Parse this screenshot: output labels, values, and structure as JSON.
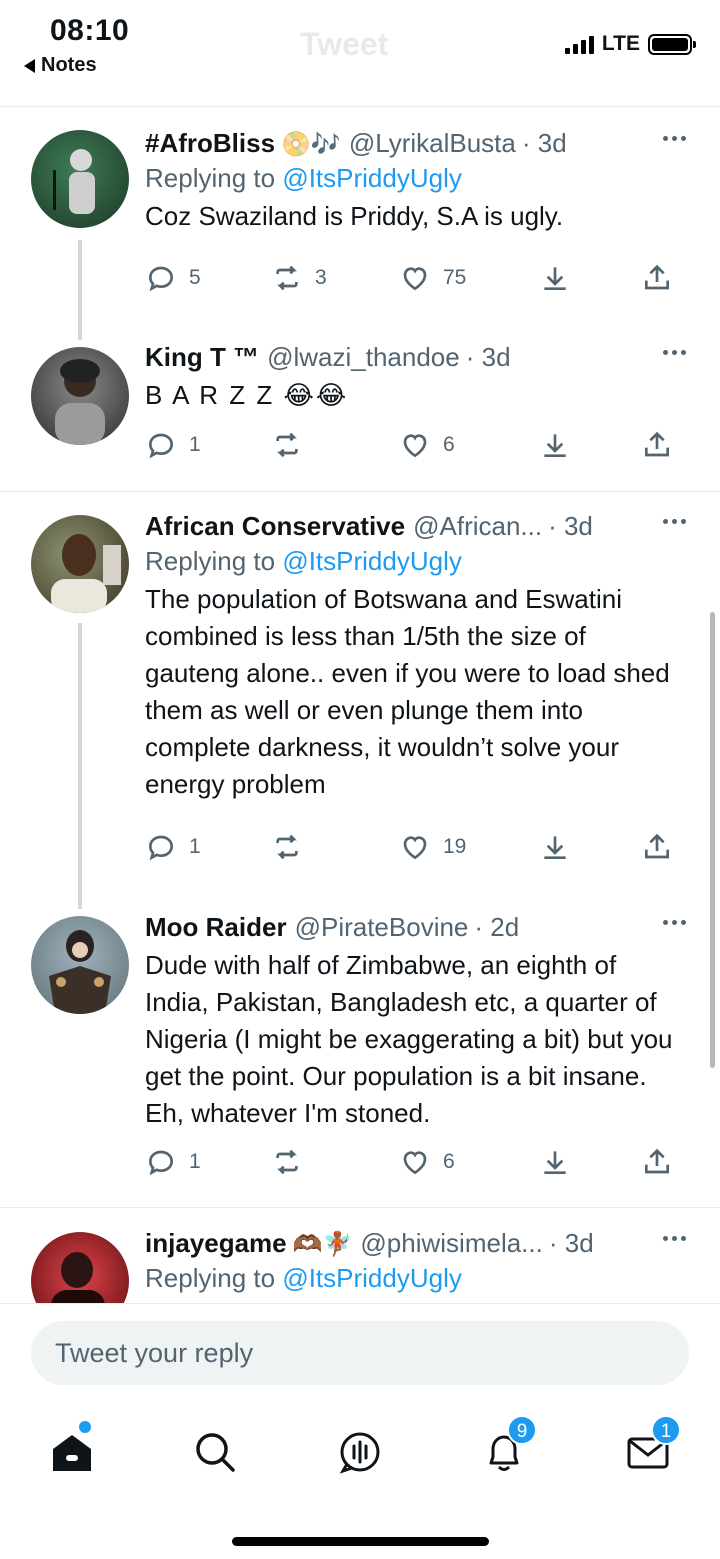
{
  "status_bar": {
    "time": "08:10",
    "back_app": "Notes",
    "network": "LTE",
    "ghost_title": "Tweet"
  },
  "tweets": [
    {
      "name": "#AfroBliss",
      "name_emoji": "📀🎶",
      "handle": "@LyrikalBusta",
      "time": "· 3d",
      "reply_prefix": "Replying to",
      "reply_to": "@ItsPriddyUgly",
      "text": "Coz Swaziland is Priddy, S.A is ugly.",
      "replies": "5",
      "retweets": "3",
      "likes": "75",
      "avatar_colors": [
        "#3e7d55",
        "#1c3626"
      ]
    },
    {
      "name": "King T ™",
      "handle": "@lwazi_thandoe",
      "time": "· 3d",
      "text": "B  A R Z Z 😂😂",
      "replies": "1",
      "retweets": "",
      "likes": "6",
      "avatar_colors": [
        "#7c7c7c",
        "#2c2c2c"
      ]
    },
    {
      "name": "African Conservative",
      "handle": "@African...",
      "time": "· 3d",
      "reply_prefix": "Replying to",
      "reply_to": "@ItsPriddyUgly",
      "text": "The population of Botswana and Eswatini combined is less than 1/5th the size of gauteng alone.. even if you were to load shed them as well or even plunge them into complete darkness, it wouldn’t solve your energy problem",
      "replies": "1",
      "retweets": "",
      "likes": "19",
      "avatar_colors": [
        "#6b7a5a",
        "#3d3022"
      ]
    },
    {
      "name": "Moo Raider",
      "handle": "@PirateBovine",
      "time": "· 2d",
      "text": "Dude with half of Zimbabwe, an eighth of India, Pakistan, Bangladesh etc, a quarter of Nigeria  (I might be exaggerating a bit) but you get the point. Our population is a bit insane. Eh, whatever I'm stoned.",
      "replies": "1",
      "retweets": "",
      "likes": "6",
      "avatar_colors": [
        "#8fa3ad",
        "#2d2a26"
      ]
    },
    {
      "name": "injayegame",
      "name_emoji": "🫶🏾🧚🏾",
      "handle": "@phiwisimela...",
      "time": "· 3d",
      "reply_prefix": "Replying to",
      "reply_to": "@ItsPriddyUgly",
      "avatar_colors": [
        "#c7262c",
        "#5a0c10"
      ]
    }
  ],
  "reply_placeholder": "Tweet your reply",
  "tabbar": {
    "notifications_badge": "9",
    "messages_badge": "1"
  },
  "colors": {
    "accent": "#1d9bf0",
    "secondary_text": "#536471"
  }
}
